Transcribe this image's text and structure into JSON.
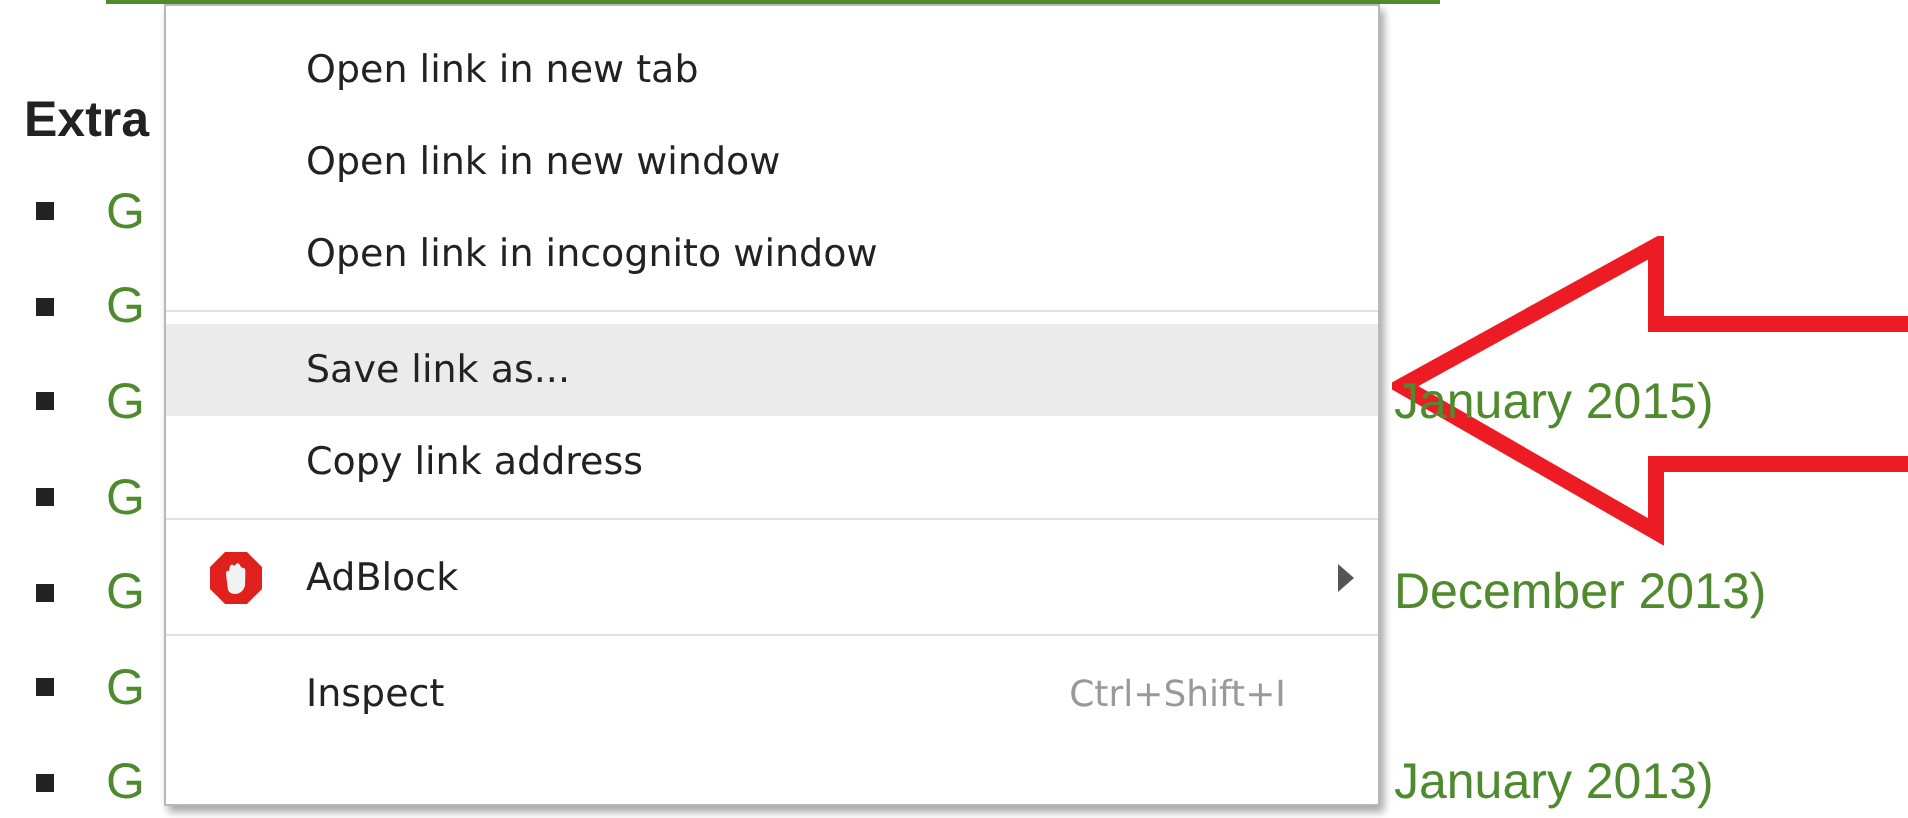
{
  "page": {
    "heading": "Extra",
    "list": [
      {
        "start": "G"
      },
      {
        "start": "G"
      },
      {
        "start": "G",
        "end": "January 2015)"
      },
      {
        "start": "G"
      },
      {
        "start": "G",
        "end": "December 2013)"
      },
      {
        "start": "G"
      },
      {
        "start": "G",
        "end": "January 2013)"
      }
    ]
  },
  "context_menu": {
    "groups": [
      {
        "items": [
          {
            "kind": "item",
            "label": "Open link in new tab",
            "selected": false
          },
          {
            "kind": "item",
            "label": "Open link in new window",
            "selected": false
          },
          {
            "kind": "item",
            "label": "Open link in incognito window",
            "selected": false
          }
        ]
      },
      {
        "items": [
          {
            "kind": "item",
            "label": "Save link as...",
            "selected": true
          },
          {
            "kind": "item",
            "label": "Copy link address",
            "selected": false
          }
        ]
      },
      {
        "items": [
          {
            "kind": "extension",
            "label": "AdBlock",
            "selected": false,
            "submenu": true
          }
        ]
      },
      {
        "items": [
          {
            "kind": "item",
            "label": "Inspect",
            "selected": false,
            "shortcut": "Ctrl+Shift+I"
          }
        ]
      }
    ]
  }
}
